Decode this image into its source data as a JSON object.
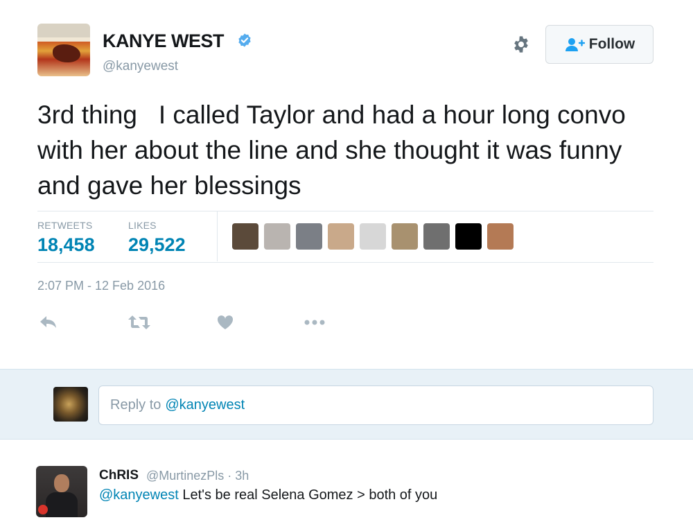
{
  "tweet": {
    "author_name": "KANYE WEST",
    "author_handle": "@kanyewest",
    "text": "3rd thing   I called Taylor and had a hour long convo with her about the line and she thought it was funny and gave her blessings",
    "timestamp": "2:07 PM - 12 Feb 2016"
  },
  "header": {
    "follow_label": "Follow",
    "gear_icon": "gear-icon",
    "verified_icon": "verified-badge-icon"
  },
  "stats": {
    "retweets_label": "RETWEETS",
    "retweets_count": "18,458",
    "likes_label": "LIKES",
    "likes_count": "29,522",
    "liker_avatars": [
      {
        "color": "#5b4a3a"
      },
      {
        "color": "#b9b4b0"
      },
      {
        "color": "#7b7f86"
      },
      {
        "color": "#c9a98a"
      },
      {
        "color": "#d7d7d7"
      },
      {
        "color": "#a8916f"
      },
      {
        "color": "#6f6f6f"
      },
      {
        "color": "#000000"
      },
      {
        "color": "#b47a55"
      }
    ]
  },
  "actions": {
    "reply_icon": "reply-icon",
    "retweet_icon": "retweet-icon",
    "like_icon": "heart-icon",
    "more_icon": "more-icon"
  },
  "reply_box": {
    "placeholder_prefix": "Reply to",
    "placeholder_mention": "@kanyewest"
  },
  "replies": [
    {
      "name": "ChRIS",
      "handle_time": "@MurtinezPls · 3h",
      "mention": "@kanyewest",
      "text": " Let's be real Selena Gomez > both of you"
    }
  ],
  "colors": {
    "accent": "#0084b4",
    "muted": "#8899a6",
    "verified": "#55acee",
    "reply_bar_bg": "#e8f1f7"
  }
}
